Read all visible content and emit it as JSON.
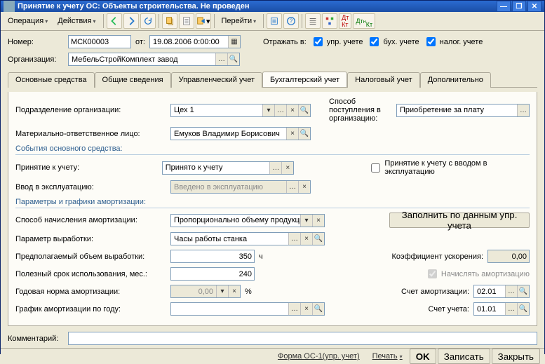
{
  "title": "Принятие к учету ОС: Объекты строительства. Не проведен",
  "menubar": {
    "operation": "Операция",
    "actions": "Действия",
    "goto": "Перейти"
  },
  "header": {
    "number_label": "Номер:",
    "number_value": "МСК00003",
    "from_label": "от:",
    "date_value": "19.08.2006 0:00:00",
    "reflect_label": "Отражать в:",
    "chk_upr": "упр. учете",
    "chk_buh": "бух. учете",
    "chk_nal": "налог. учете",
    "org_label": "Организация:",
    "org_value": "МебельСтройКомплект завод"
  },
  "tabs": {
    "tab1": "Основные средства",
    "tab2": "Общие сведения",
    "tab3": "Управленческий учет",
    "tab4": "Бухгалтерский учет",
    "tab5": "Налоговый учет",
    "tab6": "Дополнительно"
  },
  "page": {
    "subdiv_label": "Подразделение организации:",
    "subdiv_value": "Цех 1",
    "mol_label": "Материально-ответственное лицо:",
    "mol_value": "Емуков Владимир Борисович",
    "way_label": "Способ поступления в организацию:",
    "way_value": "Приобретение за плату",
    "events_title": "События основного средства:",
    "accept_label": "Принятие к учету:",
    "accept_value": "Принято к учету",
    "accept_chk": "Принятие к учету с вводом в эксплуатацию",
    "commission_label": "Ввод в эксплуатацию:",
    "commission_placeholder": "Введено в эксплуатацию",
    "amort_title": "Параметры и графики амортизации:",
    "amort_method_label": "Способ начисления амортизации:",
    "amort_method_value": "Пропорционально объему продукции (работ",
    "fill_btn": "Заполнить по данным упр. учета",
    "param_label": "Параметр выработки:",
    "param_value": "Часы работы станка",
    "expected_label": "Предполагаемый объем выработки:",
    "expected_value": "350",
    "expected_unit": "ч",
    "coef_label": "Коэффициент ускорения:",
    "coef_value": "0,00",
    "useful_label": "Полезный срок использования, мес.:",
    "useful_value": "240",
    "calc_amort_chk": "Начислять амортизацию",
    "annual_label": "Годовая норма амортизации:",
    "annual_value": "0,00",
    "annual_unit": "%",
    "amort_account_label": "Счет амортизации:",
    "amort_account_value": "02.01",
    "schedule_label": "График амортизации по году:",
    "account_label": "Счет учета:",
    "account_value": "01.01"
  },
  "comment_label": "Комментарий:",
  "footer": {
    "form": "Форма ОС-1(упр. учет)",
    "print": "Печать",
    "ok": "OK",
    "save": "Записать",
    "close": "Закрыть"
  }
}
